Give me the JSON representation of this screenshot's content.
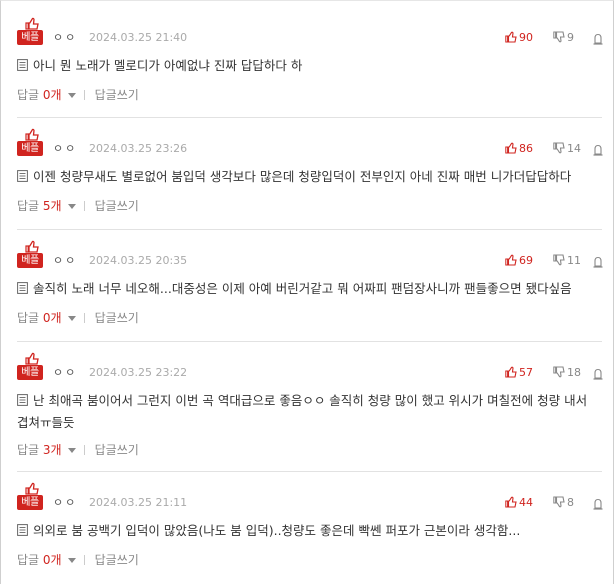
{
  "comments": [
    {
      "badge": "베플",
      "nickname": "ㅇㅇ",
      "date": "2024.03.25 21:40",
      "likes": "90",
      "dislikes": "9",
      "text": "아니 뭔 노래가 멜로디가 아예없냐 진짜 답답하다 하",
      "reply_label": "답글",
      "reply_count": "0개",
      "write_reply": "답글쓰기"
    },
    {
      "badge": "베플",
      "nickname": "ㅇㅇ",
      "date": "2024.03.25 23:26",
      "likes": "86",
      "dislikes": "14",
      "text": "이젠 청량무새도 별로없어 붐입덕 생각보다 많은데 청량입덕이 전부인지 아네 진짜 매번 니가더답답하다",
      "reply_label": "답글",
      "reply_count": "5개",
      "write_reply": "답글쓰기"
    },
    {
      "badge": "베플",
      "nickname": "ㅇㅇ",
      "date": "2024.03.25 20:35",
      "likes": "69",
      "dislikes": "11",
      "text": "솔직히 노래 너무 네오해...대중성은 이제 아예 버린거같고 뭐 어짜피 팬덤장사니까 팬들좋으면 됐다싶음",
      "reply_label": "답글",
      "reply_count": "0개",
      "write_reply": "답글쓰기"
    },
    {
      "badge": "베플",
      "nickname": "ㅇㅇ",
      "date": "2024.03.25 23:22",
      "likes": "57",
      "dislikes": "18",
      "text": "난 최애곡 붐이어서 그런지 이번 곡 역대급으로 좋음ㅇㅇ 솔직히 청량 많이 했고 위시가 며칠전에 청량 내서 겹쳐ㅠ들듯",
      "reply_label": "답글",
      "reply_count": "3개",
      "write_reply": "답글쓰기"
    },
    {
      "badge": "베플",
      "nickname": "ㅇㅇ",
      "date": "2024.03.25 21:11",
      "likes": "44",
      "dislikes": "8",
      "text": "의외로 붐 공백기 입덕이 많았음(나도 붐 입덕)..청량도 좋은데 빡쎈 퍼포가 근본이라 생각함...",
      "reply_label": "답글",
      "reply_count": "0개",
      "write_reply": "답글쓰기"
    }
  ],
  "colors": {
    "accent": "#d0241f",
    "muted": "#888888",
    "date": "#aaaaaa"
  },
  "icons": {
    "best": "thumbs-up-icon",
    "like": "thumbs-up-icon",
    "dislike": "thumbs-down-icon",
    "report": "siren-icon",
    "content": "document-icon",
    "reply_toggle": "caret-down-icon"
  }
}
